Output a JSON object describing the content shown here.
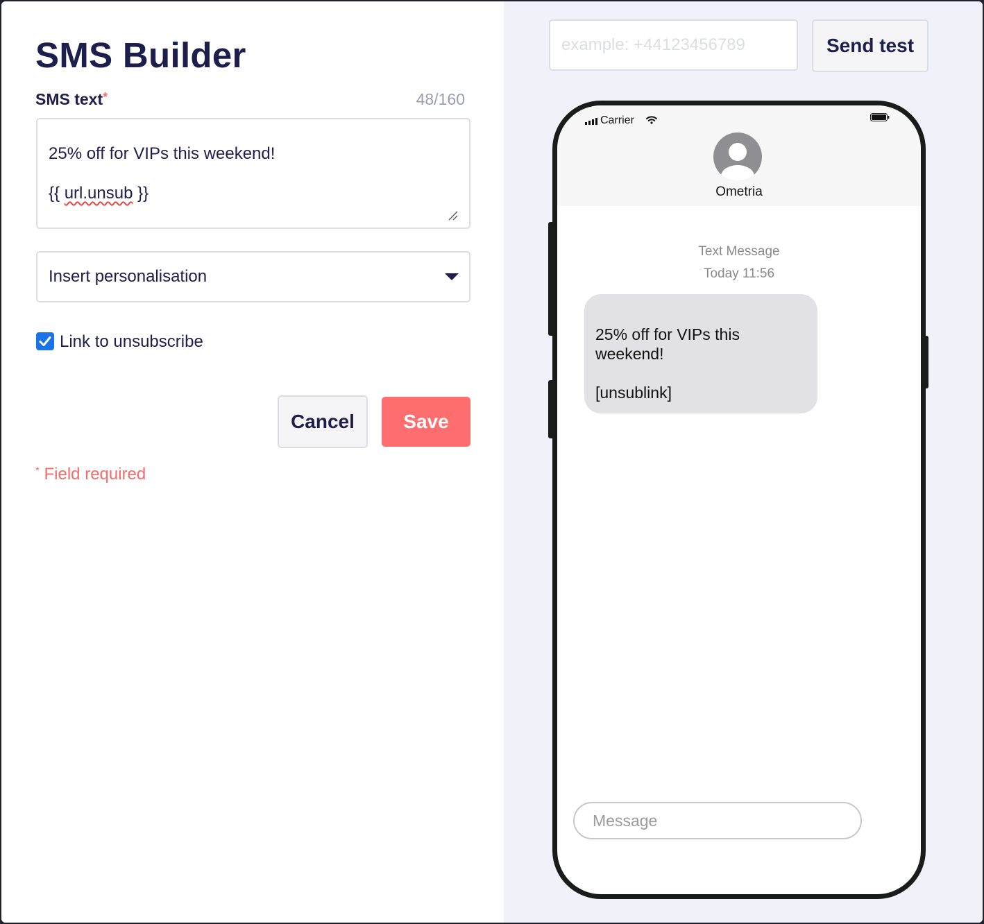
{
  "builder": {
    "title": "SMS Builder",
    "sms_text_label": "SMS text",
    "required_star": "*",
    "char_count": "48/160",
    "sms_line_1": "25% off for VIPs this weekend!",
    "sms_line_2_open": "{{ ",
    "sms_line_2_token": "url.unsub",
    "sms_line_2_close": " }}",
    "personalisation_select": "Insert personalisation",
    "unsubscribe_checkbox_label": "Link to unsubscribe",
    "unsubscribe_checked": true,
    "cancel_label": "Cancel",
    "save_label": "Save",
    "field_required_star": "*",
    "field_required_text": " Field required"
  },
  "test_send": {
    "phone_placeholder": "example: +44123456789",
    "send_test_label": "Send test"
  },
  "preview": {
    "carrier": "Carrier",
    "contact_name": "Ometria",
    "message_type": "Text Message",
    "timestamp": "Today 11:56",
    "bubble_line_1": "25% off for VIPs this\nweekend!",
    "bubble_line_2": "[unsublink]",
    "message_placeholder": "Message"
  },
  "colors": {
    "primary_text": "#1d1e4c",
    "accent_red": "#ff6e6e",
    "checkbox_blue": "#1a73e8",
    "preview_background": "#f0f1f9"
  },
  "icons": {
    "dropdown": "chevron-down-icon",
    "checkbox": "checkmark-icon",
    "signal": "signal-bars-icon",
    "wifi": "wifi-icon",
    "battery": "battery-icon",
    "avatar": "user-avatar-icon",
    "resize": "resize-handle-icon"
  }
}
